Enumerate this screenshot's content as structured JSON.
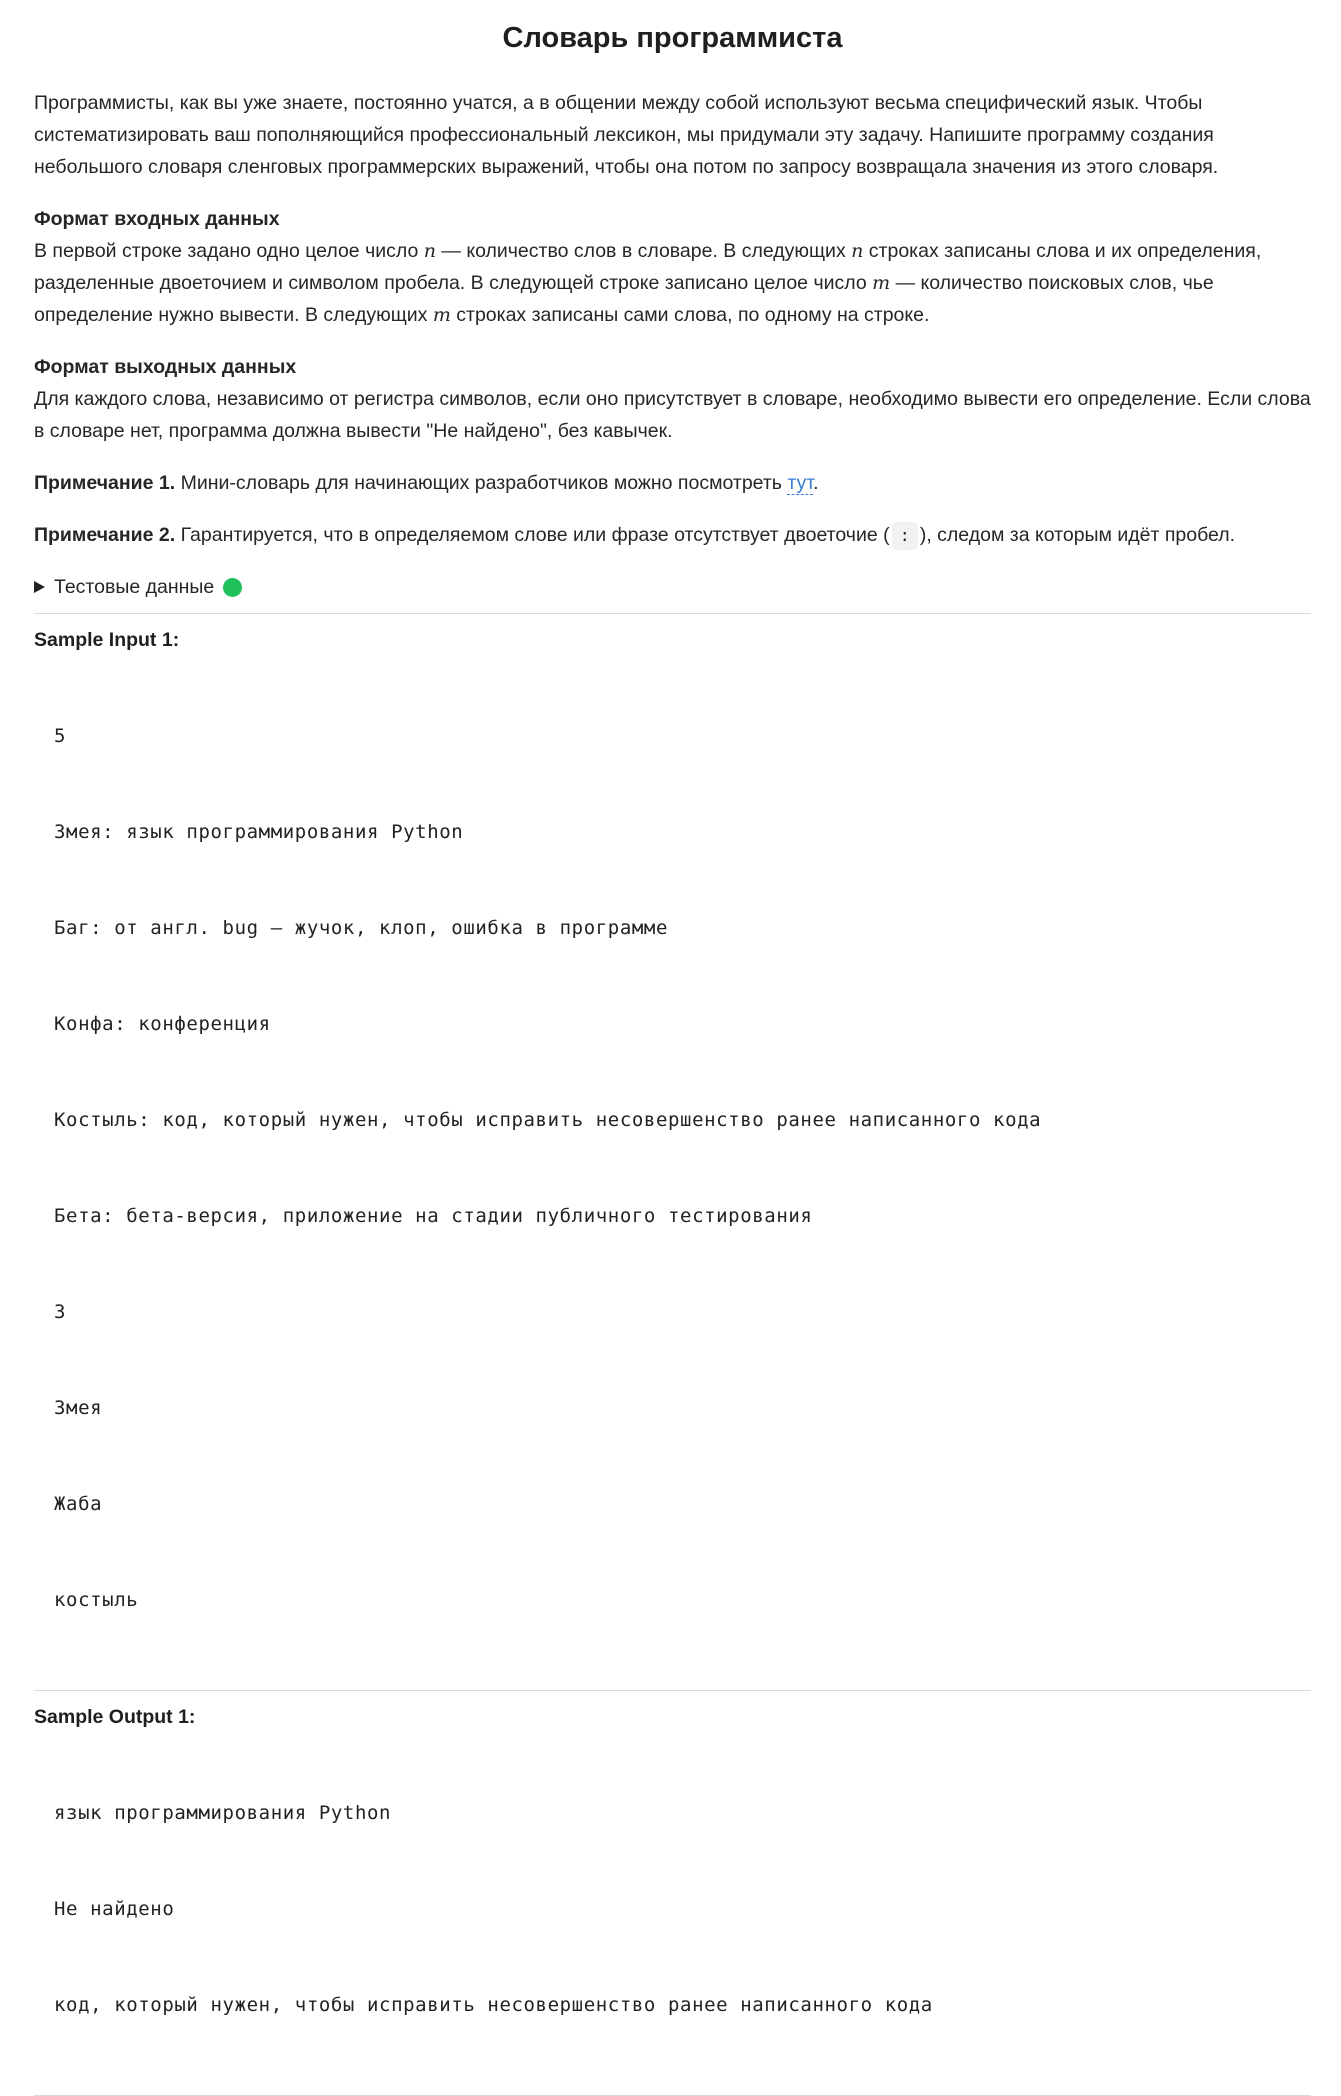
{
  "title": "Словарь программиста",
  "intro": "Программисты, как вы уже знаете, постоянно учатся, а в общении между собой используют весьма специфический язык. Чтобы систематизировать ваш пополняющийся профессиональный лексикон, мы придумали эту задачу. Напишите программу создания небольшого словаря сленговых программерских выражений, чтобы она потом по запросу возвращала значения из этого словаря.",
  "input_format": {
    "heading": "Формат входных данных",
    "t1": "В первой строке задано одно целое число ",
    "v1": "n",
    "t2": " — количество слов в словаре. В следующих ",
    "v2": "n",
    "t3": " строках записаны слова и их определения, разделенные двоеточием и символом пробела. В следующей строке записано целое число ",
    "v3": "m",
    "t4": " — количество поисковых слов, чье определение нужно вывести. В следующих ",
    "v4": "m",
    "t5": " строках записаны сами слова, по одному на строке."
  },
  "output_format": {
    "heading": "Формат выходных данных",
    "text": "Для каждого слова, независимо от регистра символов, если оно присутствует в словаре, необходимо вывести его определение. Если слова в словаре нет, программа должна вывести \"Не найдено\", без кавычек."
  },
  "note1": {
    "label": "Примечание 1.",
    "text": " Мини-словарь для начинающих разработчиков можно посмотреть ",
    "link": "тут",
    "end": "."
  },
  "note2": {
    "label": "Примечание 2.",
    "text_before": " Гарантируется, что в определяемом слове или фразе отсутствует двоеточие (",
    "code": ":",
    "text_after": "), следом за которым идёт пробел."
  },
  "test_data": {
    "label": "Тестовые данные",
    "triangle_icon": "disclosure-triangle-right",
    "status_color": "#20c05c"
  },
  "samples": [
    {
      "title": "Sample Input 1:",
      "lines": [
        "5",
        "Змея: язык программирования Python",
        "Баг: от англ. bug — жучок, клоп, ошибка в программе",
        "Конфа: конференция",
        "Костыль: код, который нужен, чтобы исправить несовершенство ранее написанного кода",
        "Бета: бета-версия, приложение на стадии публичного тестирования",
        "3",
        "Змея",
        "Жаба",
        "костыль"
      ]
    },
    {
      "title": "Sample Output 1:",
      "lines": [
        "язык программирования Python",
        "Не найдено",
        "код, который нужен, чтобы исправить несовершенство ранее написанного кода"
      ]
    }
  ]
}
